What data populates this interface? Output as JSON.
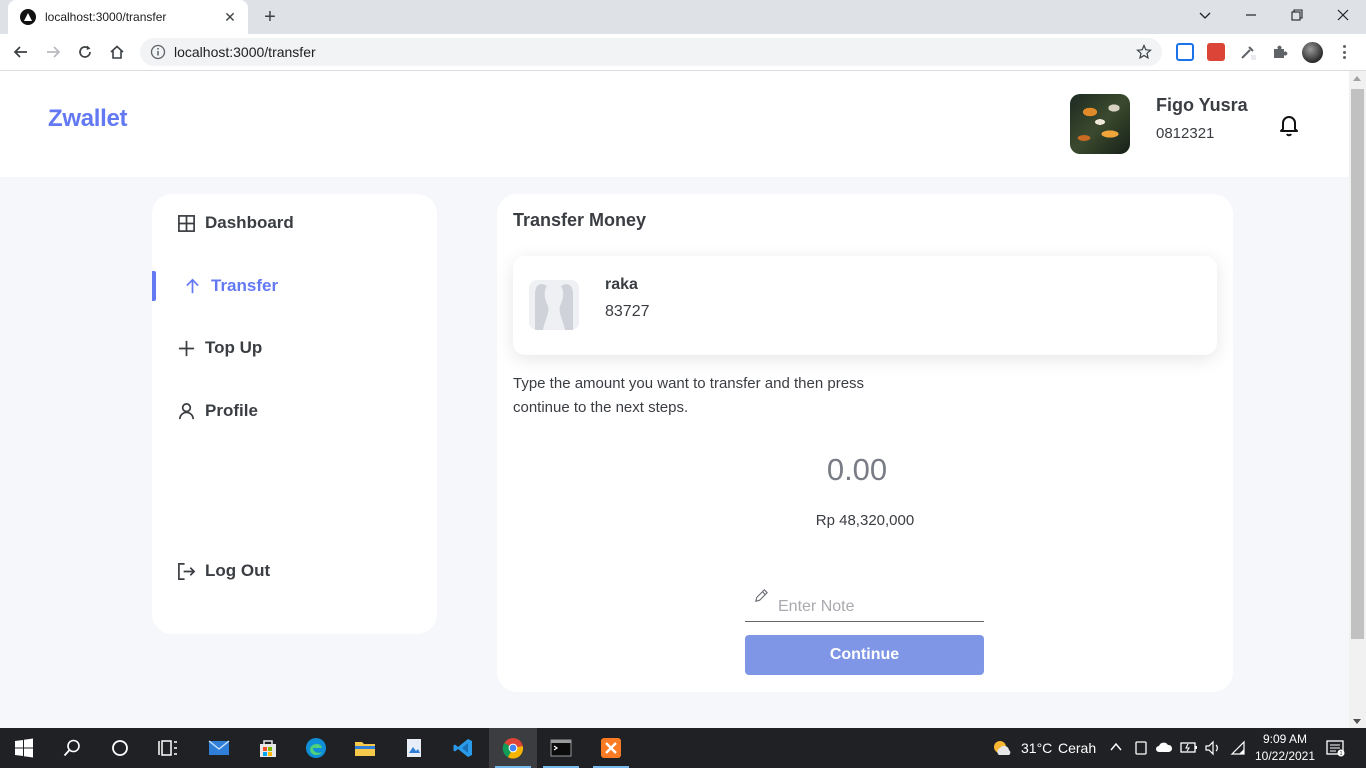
{
  "browser": {
    "tab_title": "localhost:3000/transfer",
    "url": "localhost:3000/transfer"
  },
  "header": {
    "brand": "Zwallet",
    "user_name": "Figo Yusra",
    "user_phone": "0812321"
  },
  "sidebar": {
    "items": [
      {
        "label": "Dashboard",
        "icon": "grid-icon"
      },
      {
        "label": "Transfer",
        "icon": "arrow-up-icon",
        "active": true
      },
      {
        "label": "Top Up",
        "icon": "plus-icon"
      },
      {
        "label": "Profile",
        "icon": "user-icon"
      }
    ],
    "logout_label": "Log Out"
  },
  "transfer": {
    "title": "Transfer Money",
    "recipient": {
      "name": "raka",
      "phone": "83727"
    },
    "instructions": "Type the amount you want to transfer and then press continue to the next steps.",
    "amount_placeholder": "0.00",
    "balance": "Rp 48,320,000",
    "note_placeholder": "Enter Note",
    "continue_label": "Continue"
  },
  "taskbar": {
    "weather_temp": "31°C",
    "weather_text": "Cerah",
    "time": "9:09 AM",
    "date": "10/22/2021"
  },
  "colors": {
    "accent": "#6379f4",
    "button": "#7f96e6",
    "page_bg": "#f6f7fb"
  }
}
